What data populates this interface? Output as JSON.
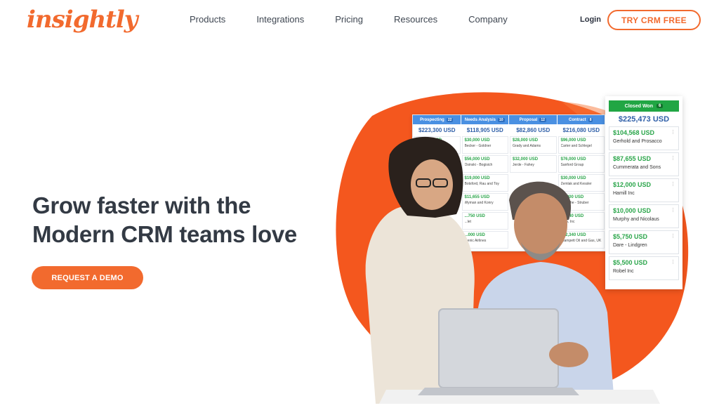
{
  "header": {
    "logo": "insightly",
    "nav": [
      "Products",
      "Integrations",
      "Pricing",
      "Resources",
      "Company"
    ],
    "login": "Login",
    "cta": "TRY CRM FREE"
  },
  "hero": {
    "headline_line1": "Grow faster with the",
    "headline_line2": "Modern CRM teams love",
    "demo_button": "REQUEST A DEMO"
  },
  "pipeline": {
    "stages": [
      {
        "name": "Prospecting",
        "count": "22",
        "total": "$223,300 USD"
      },
      {
        "name": "Needs Analysis",
        "count": "10",
        "total": "$118,905 USD"
      },
      {
        "name": "Proposal",
        "count": "12",
        "total": "$82,860 USD"
      },
      {
        "name": "Contract",
        "count": "8",
        "total": "$216,080 USD"
      }
    ],
    "columns": [
      [
        {
          "amount": "$90,000 USD",
          "name": "...ms"
        }
      ],
      [
        {
          "amount": "$30,000 USD",
          "name": "Becker - Goldner"
        },
        {
          "amount": "$56,000 USD",
          "name": "Osinski - Bogisich"
        },
        {
          "amount": "$19,000 USD",
          "name": "Botsford, Rau and Toy"
        },
        {
          "amount": "$11,655 USD",
          "name": "Wyman and Konry"
        },
        {
          "amount": "...750 USD",
          "name": "...let"
        },
        {
          "amount": "...000 USD",
          "name": "...enic Airlines"
        }
      ],
      [
        {
          "amount": "$28,000 USD",
          "name": "Grady and Adams"
        },
        {
          "amount": "$32,000 USD",
          "name": "Jerde - Fahey"
        }
      ],
      [
        {
          "amount": "$96,000 USD",
          "name": "Carter and Schlegel"
        },
        {
          "amount": "$76,000 USD",
          "name": "Sanford Group"
        },
        {
          "amount": "$30,000 USD",
          "name": "Zemlak and Kessler"
        },
        {
          "amount": "$9,200 USD",
          "name": "Nitzsche - Struber"
        },
        {
          "amount": "$4,540 USD",
          "name": "TRG, Inc"
        },
        {
          "amount": "$12,340 USD",
          "name": "Olampett Oil and Gas, UK"
        }
      ]
    ]
  },
  "closed_won": {
    "title": "Closed Won",
    "count": "6",
    "total": "$225,473 USD",
    "deals": [
      {
        "amount": "$104,568 USD",
        "name": "Gerhold and Prosacco"
      },
      {
        "amount": "$87,655 USD",
        "name": "Cummerata and Sons"
      },
      {
        "amount": "$12,000 USD",
        "name": "Hamill Inc"
      },
      {
        "amount": "$10,000 USD",
        "name": "Murphy and Nicolaus"
      },
      {
        "amount": "$5,750 USD",
        "name": "Dare - Lindgren"
      },
      {
        "amount": "$5,500 USD",
        "name": "Robel Inc"
      }
    ]
  },
  "colors": {
    "brand": "#f26a2e",
    "text": "#333a44",
    "won_green": "#21a644",
    "stage_blue": "#4a90e2"
  },
  "icons": {
    "card_menu": "dots-icon"
  }
}
